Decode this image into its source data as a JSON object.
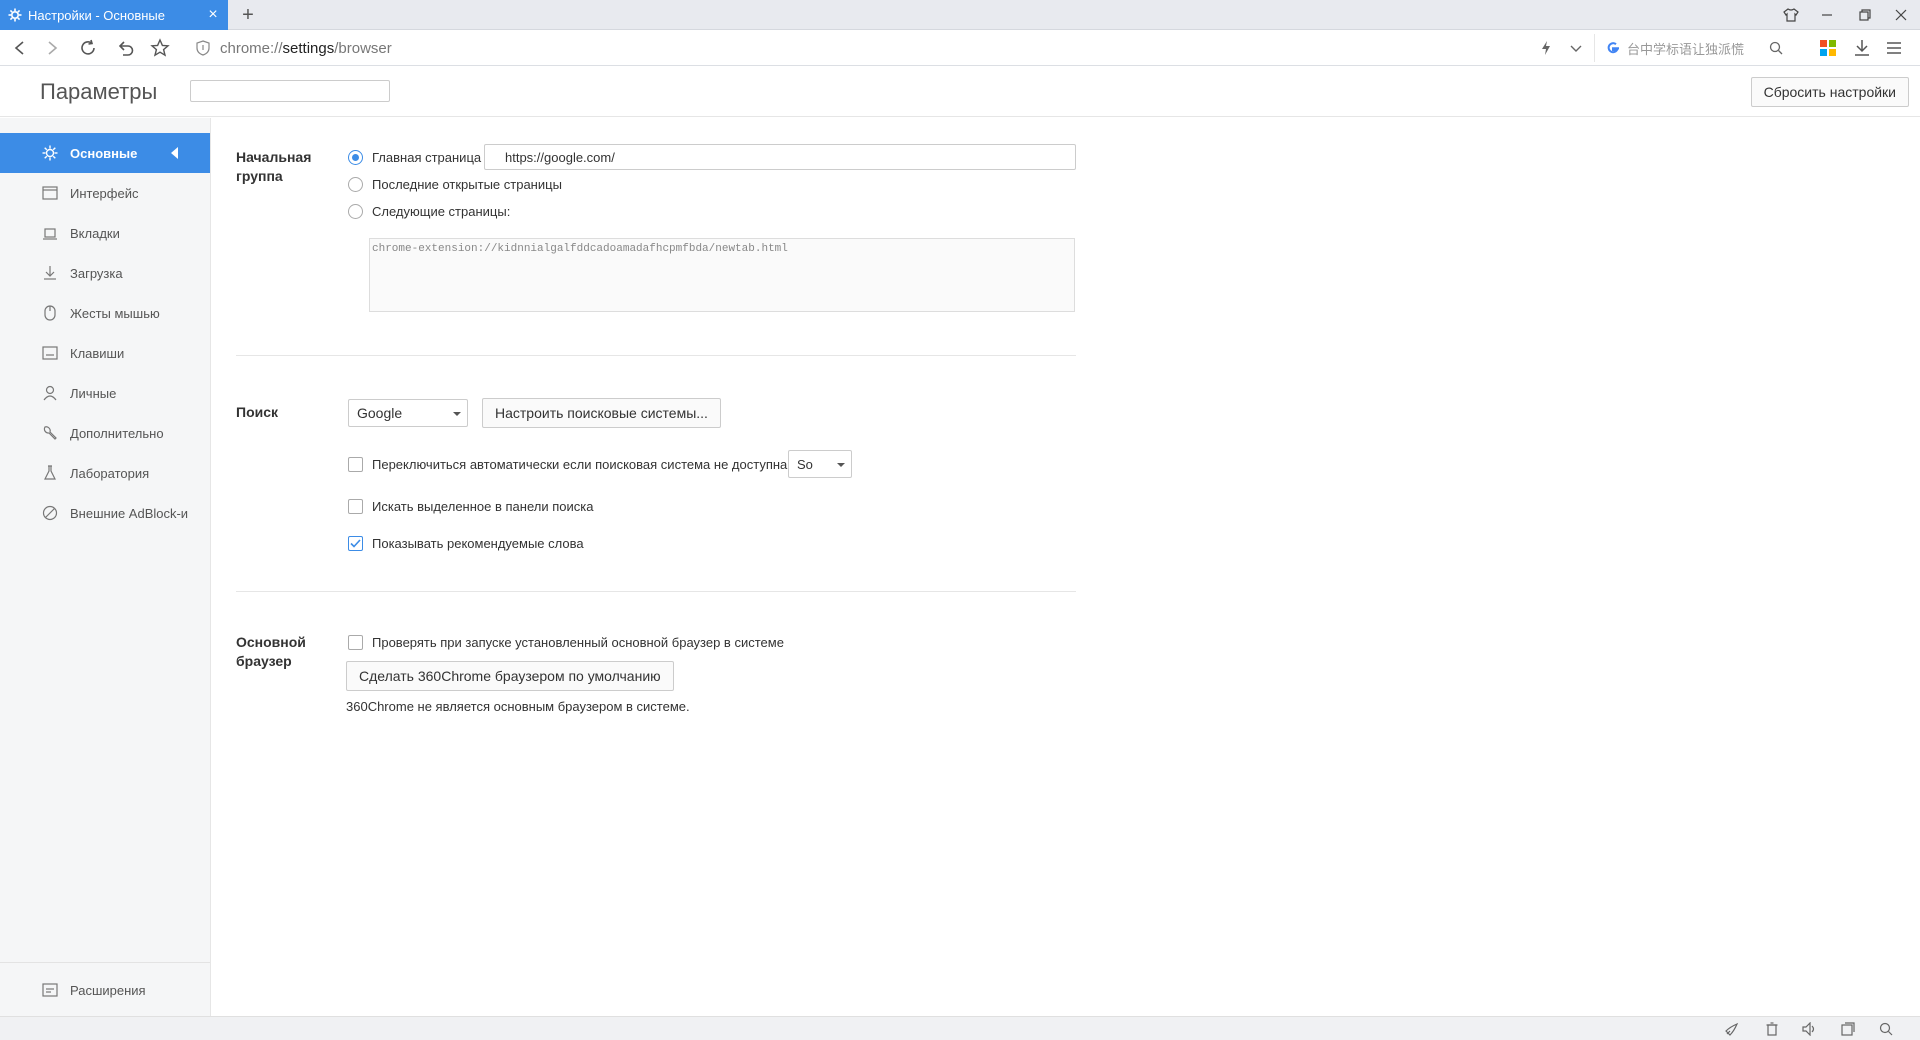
{
  "tab": {
    "title": "Настройки - Основные",
    "icon": "gear-icon",
    "close": "×"
  },
  "window_controls": [
    "skin-icon",
    "minimize-icon",
    "restore-icon",
    "close-icon"
  ],
  "address": {
    "scheme": "chrome://",
    "host": "settings",
    "path": "/browser"
  },
  "search_box": {
    "placeholder": "台中学标语让独派慌",
    "engine_icon": "google-icon"
  },
  "header": {
    "title": "Параметры",
    "search_placeholder": "",
    "reset_label": "Сбросить настройки"
  },
  "sidebar": {
    "items": [
      {
        "label": "Основные",
        "icon": "gear-icon",
        "active": true
      },
      {
        "label": "Интерфейс",
        "icon": "window-icon"
      },
      {
        "label": "Вкладки",
        "icon": "tab-icon"
      },
      {
        "label": "Загрузка",
        "icon": "download-icon"
      },
      {
        "label": "Жесты мышью",
        "icon": "mouse-icon"
      },
      {
        "label": "Клавиши",
        "icon": "keyboard-icon"
      },
      {
        "label": "Личные",
        "icon": "person-icon"
      },
      {
        "label": "Дополнительно",
        "icon": "wrench-icon"
      },
      {
        "label": "Лаборатория",
        "icon": "flask-icon"
      },
      {
        "label": "Внешние AdBlock-и",
        "icon": "block-icon"
      }
    ],
    "bottom": {
      "label": "Расширения",
      "icon": "extensions-icon"
    }
  },
  "startup": {
    "label": "Начальная группа",
    "homepage_label": "Главная страница",
    "homepage_value": "https://google.com/",
    "last_pages_label": "Последние открытые страницы",
    "specific_pages_label": "Следующие страницы:",
    "specific_pages_value": "chrome-extension://kidnnialgalfddcadoamadafhcpmfbda/newtab.html",
    "selected": "homepage"
  },
  "search": {
    "label": "Поиск",
    "engine": "Google",
    "manage_label": "Настроить поисковые системы...",
    "auto_switch_label": "Переключиться автоматически если поисковая система не доступна",
    "fallback_engine": "So",
    "auto_switch_checked": false,
    "selected_text_label": "Искать выделенное в панели поиска",
    "selected_text_checked": false,
    "suggestions_label": "Показывать рекомендуемые слова",
    "suggestions_checked": true
  },
  "default_browser": {
    "label": "Основной браузер",
    "check_label": "Проверять при запуске установленный основной браузер в системе",
    "check_checked": false,
    "make_default_label": "Сделать 360Chrome браузером по умолчанию",
    "status_text": "360Chrome не является основным браузером в системе."
  },
  "statusbar_icons": [
    "rocket-icon",
    "trash-icon",
    "volume-icon",
    "window-icon",
    "search-icon"
  ],
  "colors": {
    "accent": "#3c8ce6",
    "sidebar_bg": "#f5f6f7",
    "tabstrip_bg": "#e8eaef"
  }
}
